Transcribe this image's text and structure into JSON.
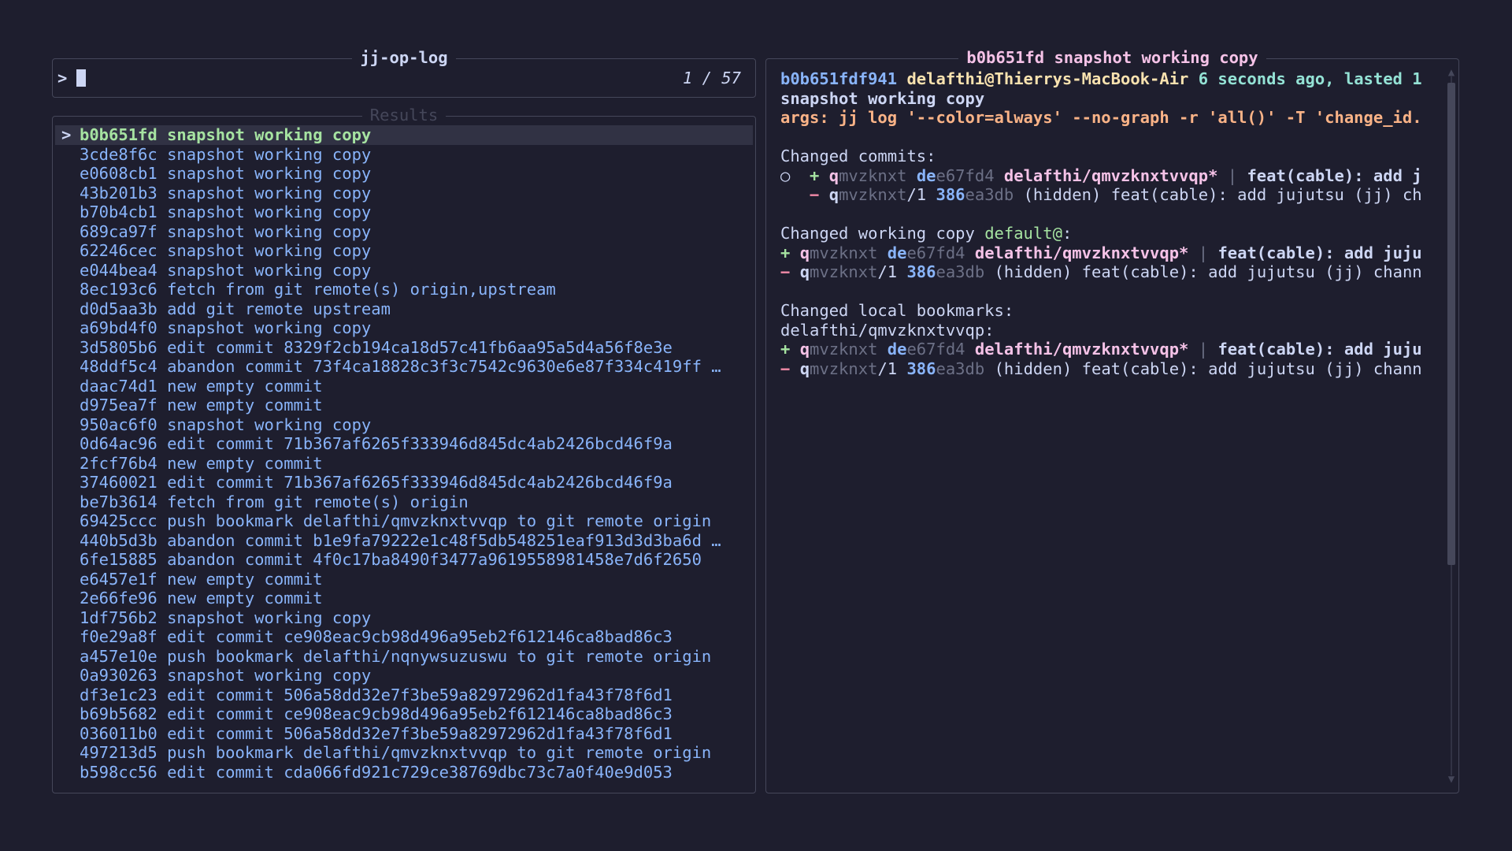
{
  "input": {
    "title": "jj-op-log",
    "prompt": ">",
    "counter": "1 / 57"
  },
  "results": {
    "title": "Results",
    "selected_marker": ">",
    "items": [
      {
        "id": "b0b651fd",
        "desc": "snapshot working copy"
      },
      {
        "id": "3cde8f6c",
        "desc": "snapshot working copy"
      },
      {
        "id": "e0608cb1",
        "desc": "snapshot working copy"
      },
      {
        "id": "43b201b3",
        "desc": "snapshot working copy"
      },
      {
        "id": "b70b4cb1",
        "desc": "snapshot working copy"
      },
      {
        "id": "689ca97f",
        "desc": "snapshot working copy"
      },
      {
        "id": "62246cec",
        "desc": "snapshot working copy"
      },
      {
        "id": "e044bea4",
        "desc": "snapshot working copy"
      },
      {
        "id": "8ec193c6",
        "desc": "fetch from git remote(s) origin,upstream"
      },
      {
        "id": "d0d5aa3b",
        "desc": "add git remote upstream"
      },
      {
        "id": "a69bd4f0",
        "desc": "snapshot working copy"
      },
      {
        "id": "3d5805b6",
        "desc": "edit commit 8329f2cb194ca18d57c41fb6aa95a5d4a56f8e3e"
      },
      {
        "id": "48ddf5c4",
        "desc": "abandon commit 73f4ca18828c3f3c7542c9630e6e87f334c419ff …"
      },
      {
        "id": "daac74d1",
        "desc": "new empty commit"
      },
      {
        "id": "d975ea7f",
        "desc": "new empty commit"
      },
      {
        "id": "950ac6f0",
        "desc": "snapshot working copy"
      },
      {
        "id": "0d64ac96",
        "desc": "edit commit 71b367af6265f333946d845dc4ab2426bcd46f9a"
      },
      {
        "id": "2fcf76b4",
        "desc": "new empty commit"
      },
      {
        "id": "37460021",
        "desc": "edit commit 71b367af6265f333946d845dc4ab2426bcd46f9a"
      },
      {
        "id": "be7b3614",
        "desc": "fetch from git remote(s) origin"
      },
      {
        "id": "69425ccc",
        "desc": "push bookmark delafthi/qmvzknxtvvqp to git remote origin"
      },
      {
        "id": "440b5d3b",
        "desc": "abandon commit b1e9fa79222e1c48f5db548251eaf913d3d3ba6d …"
      },
      {
        "id": "6fe15885",
        "desc": "abandon commit 4f0c17ba8490f3477a9619558981458e7d6f2650"
      },
      {
        "id": "e6457e1f",
        "desc": "new empty commit"
      },
      {
        "id": "2e66fe96",
        "desc": "new empty commit"
      },
      {
        "id": "1df756b2",
        "desc": "snapshot working copy"
      },
      {
        "id": "f0e29a8f",
        "desc": "edit commit ce908eac9cb98d496a95eb2f612146ca8bad86c3"
      },
      {
        "id": "a457e10e",
        "desc": "push bookmark delafthi/nqnywsuzuswu to git remote origin"
      },
      {
        "id": "0a930263",
        "desc": "snapshot working copy"
      },
      {
        "id": "df3e1c23",
        "desc": "edit commit 506a58dd32e7f3be59a82972962d1fa43f78f6d1"
      },
      {
        "id": "b69b5682",
        "desc": "edit commit ce908eac9cb98d496a95eb2f612146ca8bad86c3"
      },
      {
        "id": "036011b0",
        "desc": "edit commit 506a58dd32e7f3be59a82972962d1fa43f78f6d1"
      },
      {
        "id": "497213d5",
        "desc": "push bookmark delafthi/qmvzknxtvvqp to git remote origin"
      },
      {
        "id": "b598cc56",
        "desc": "edit commit cda066fd921c729ce38769dbc73c7a0f40e9d053"
      }
    ]
  },
  "preview": {
    "title": "b0b651fd snapshot working copy",
    "header": {
      "op_id": "b0b651fdf941",
      "user": "delafthi@Thierrys-MacBook-Air",
      "time": "6 seconds ago, lasted 1",
      "description": "snapshot working copy",
      "args": "args: jj log '--color=always' --no-graph -r 'all()' -T 'change_id."
    },
    "changed_commits": {
      "heading": "Changed commits:",
      "graph_node": "○",
      "added": {
        "sign": "+",
        "change_prefix": "q",
        "change_rest": "mvzknxt",
        "commit_prefix": "de",
        "commit_rest": "e67fd4",
        "bookmark": "delafthi/qmvzknxtvvqp*",
        "sep": "|",
        "message": "feat(cable): add j"
      },
      "removed": {
        "sign": "−",
        "change_prefix": "q",
        "change_rest": "mvzknxt",
        "suffix": "/1",
        "commit_prefix": "386",
        "commit_rest": "ea3db",
        "hidden": "(hidden)",
        "message": "feat(cable): add jujutsu (jj) ch"
      }
    },
    "changed_working_copy": {
      "heading": "Changed working copy ",
      "workspace": "default@",
      "colon": ":",
      "added": {
        "sign": "+",
        "change_prefix": "q",
        "change_rest": "mvzknxt",
        "commit_prefix": "de",
        "commit_rest": "e67fd4",
        "bookmark": "delafthi/qmvzknxtvvqp*",
        "sep": "|",
        "message": "feat(cable): add juju"
      },
      "removed": {
        "sign": "−",
        "change_prefix": "q",
        "change_rest": "mvzknxt",
        "suffix": "/1",
        "commit_prefix": "386",
        "commit_rest": "ea3db",
        "hidden": "(hidden)",
        "message": "feat(cable): add jujutsu (jj) chann"
      }
    },
    "changed_bookmarks": {
      "heading": "Changed local bookmarks:",
      "bookmark_name": "delafthi/qmvzknxtvvqp:",
      "added": {
        "sign": "+",
        "change_prefix": "q",
        "change_rest": "mvzknxt",
        "commit_prefix": "de",
        "commit_rest": "e67fd4",
        "bookmark": "delafthi/qmvzknxtvvqp*",
        "sep": "|",
        "message": "feat(cable): add juju"
      },
      "removed": {
        "sign": "−",
        "change_prefix": "q",
        "change_rest": "mvzknxt",
        "suffix": "/1",
        "commit_prefix": "386",
        "commit_rest": "ea3db",
        "hidden": "(hidden)",
        "message": "feat(cable): add jujutsu (jj) chann"
      }
    }
  },
  "scrollbar": {
    "up_arrow": "▲",
    "down_arrow": "▼"
  }
}
